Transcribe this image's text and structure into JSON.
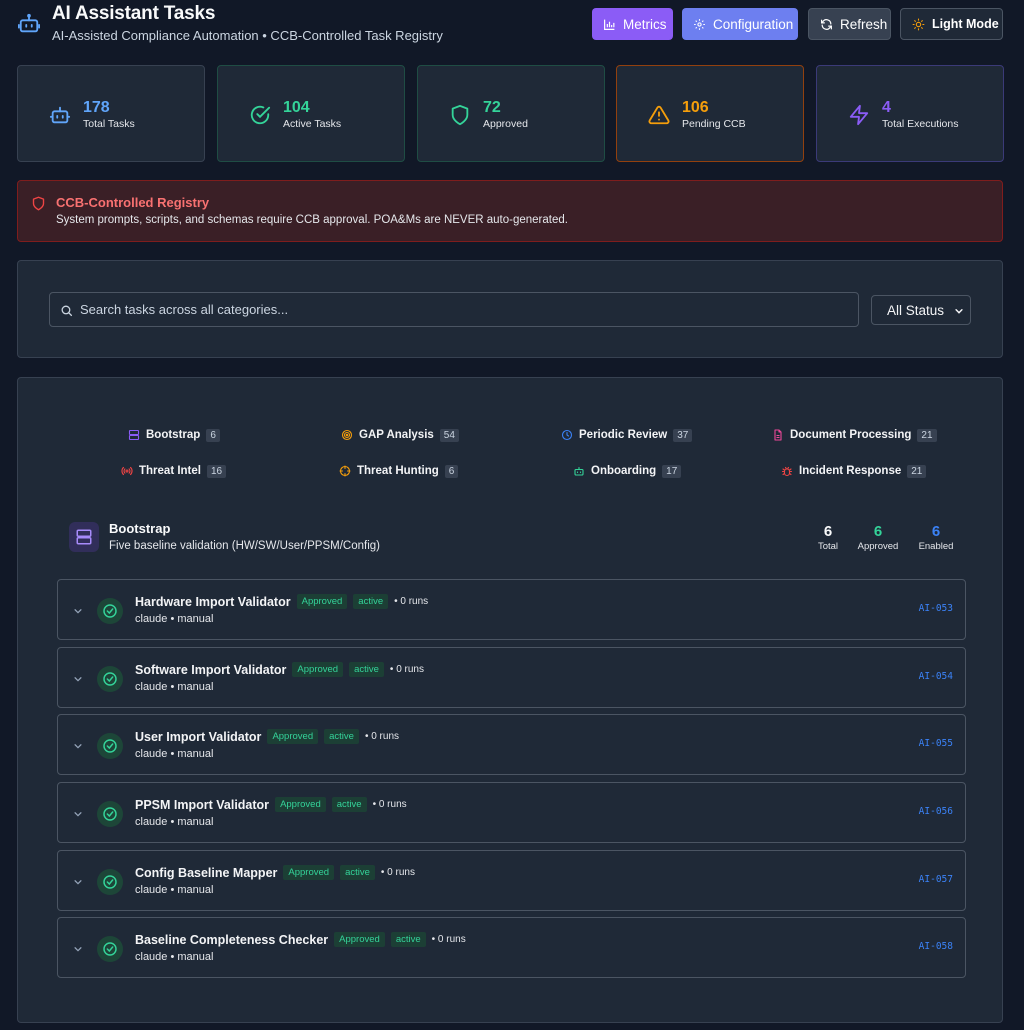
{
  "header": {
    "title": "AI Assistant Tasks",
    "subtitle": "AI-Assisted Compliance Automation • CCB-Controlled Task Registry",
    "buttons": {
      "metrics": "Metrics",
      "configuration": "Configuration",
      "refresh": "Refresh",
      "light_mode": "Light Mode"
    }
  },
  "stats": [
    {
      "value": "178",
      "label": "Total Tasks",
      "icon": "robot-icon",
      "color": "#60a5fa"
    },
    {
      "value": "104",
      "label": "Active Tasks",
      "icon": "check-circle-icon",
      "color": "#34d399"
    },
    {
      "value": "72",
      "label": "Approved",
      "icon": "shield-icon",
      "color": "#34d399"
    },
    {
      "value": "106",
      "label": "Pending CCB",
      "icon": "warning-icon",
      "color": "#f59e0b"
    },
    {
      "value": "4",
      "label": "Total Executions",
      "icon": "lightning-icon",
      "color": "#8b5cf6"
    }
  ],
  "alert": {
    "title": "CCB-Controlled Registry",
    "text": "System prompts, scripts, and schemas require CCB approval. POA&Ms are NEVER auto-generated."
  },
  "search": {
    "placeholder": "Search tasks across all categories...",
    "status_filter": "All Status"
  },
  "categories": [
    {
      "label": "Bootstrap",
      "count": "6",
      "icon": "server-icon",
      "color": "#8b5cf6"
    },
    {
      "label": "GAP Analysis",
      "count": "54",
      "icon": "target-icon",
      "color": "#f59e0b"
    },
    {
      "label": "Periodic Review",
      "count": "37",
      "icon": "clock-icon",
      "color": "#3b82f6"
    },
    {
      "label": "Document Processing",
      "count": "21",
      "icon": "document-icon",
      "color": "#ec4899"
    },
    {
      "label": "Threat Intel",
      "count": "16",
      "icon": "radio-icon",
      "color": "#ef4444"
    },
    {
      "label": "Threat Hunting",
      "count": "6",
      "icon": "crosshair-icon",
      "color": "#f59e0b"
    },
    {
      "label": "Onboarding",
      "count": "17",
      "icon": "robot-icon",
      "color": "#34d399"
    },
    {
      "label": "Incident Response",
      "count": "21",
      "icon": "bug-icon",
      "color": "#ef4444"
    }
  ],
  "section": {
    "title": "Bootstrap",
    "description": "Five baseline validation (HW/SW/User/PPSM/Config)",
    "stats": [
      {
        "value": "6",
        "label": "Total",
        "color": "#f9fafb"
      },
      {
        "value": "6",
        "label": "Approved",
        "color": "#34d399"
      },
      {
        "value": "6",
        "label": "Enabled",
        "color": "#3b82f6"
      }
    ]
  },
  "tasks": [
    {
      "name": "Hardware Import Validator",
      "status": "Approved",
      "state": "active",
      "runs": "• 0 runs",
      "meta": "claude • manual",
      "id": "AI-053"
    },
    {
      "name": "Software Import Validator",
      "status": "Approved",
      "state": "active",
      "runs": "• 0 runs",
      "meta": "claude • manual",
      "id": "AI-054"
    },
    {
      "name": "User Import Validator",
      "status": "Approved",
      "state": "active",
      "runs": "• 0 runs",
      "meta": "claude • manual",
      "id": "AI-055"
    },
    {
      "name": "PPSM Import Validator",
      "status": "Approved",
      "state": "active",
      "runs": "• 0 runs",
      "meta": "claude • manual",
      "id": "AI-056"
    },
    {
      "name": "Config Baseline Mapper",
      "status": "Approved",
      "state": "active",
      "runs": "• 0 runs",
      "meta": "claude • manual",
      "id": "AI-057"
    },
    {
      "name": "Baseline Completeness Checker",
      "status": "Approved",
      "state": "active",
      "runs": "• 0 runs",
      "meta": "claude • manual",
      "id": "AI-058"
    }
  ]
}
